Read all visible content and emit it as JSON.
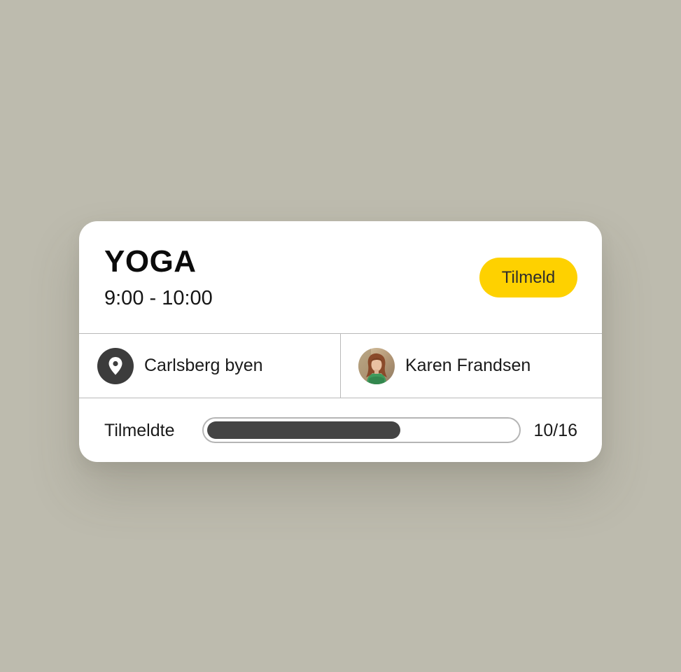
{
  "class_card": {
    "title": "YOGA",
    "time": "9:00 - 10:00",
    "signup_label": "Tilmeld",
    "location": "Carlsberg byen",
    "location_icon": "location-pin-icon",
    "instructor": "Karen Frandsen",
    "instructor_avatar": "avatar",
    "enrolled_label": "Tilmeldte",
    "enrolled_count": "10/16",
    "enrolled_fraction": 0.625
  },
  "colors": {
    "background": "#bdbbae",
    "accent": "#fed100",
    "progress_fill": "#444444"
  }
}
